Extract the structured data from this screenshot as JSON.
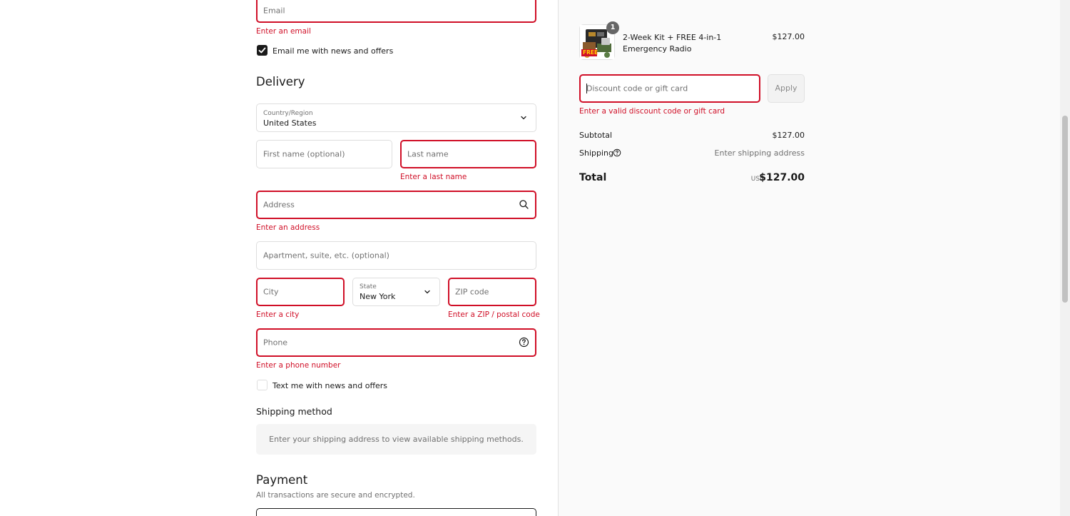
{
  "contact": {
    "email_placeholder": "Email",
    "email_error": "Enter an email",
    "news_checkbox_label": "Email me with news and offers",
    "news_checked": true
  },
  "delivery": {
    "heading": "Delivery",
    "country_label": "Country/Region",
    "country_value": "United States",
    "first_name_placeholder": "First name (optional)",
    "last_name_placeholder": "Last name",
    "last_name_error": "Enter a last name",
    "address_placeholder": "Address",
    "address_error": "Enter an address",
    "apartment_placeholder": "Apartment, suite, etc. (optional)",
    "city_placeholder": "City",
    "city_error": "Enter a city",
    "state_label": "State",
    "state_value": "New York",
    "zip_placeholder": "ZIP code",
    "zip_error": "Enter a ZIP / postal code",
    "phone_placeholder": "Phone",
    "phone_error": "Enter a phone number",
    "sms_checkbox_label": "Text me with news and offers",
    "sms_checked": false
  },
  "shipping_method": {
    "heading": "Shipping method",
    "notice": "Enter your shipping address to view available shipping methods."
  },
  "payment": {
    "heading": "Payment",
    "subtext": "All transactions are secure and encrypted."
  },
  "summary": {
    "item": {
      "quantity": "1",
      "name": "2-Week Kit + FREE 4-in-1 Emergency Radio",
      "price": "$127.00",
      "thumb_text": "FREE"
    },
    "discount_placeholder": "Discount code or gift card",
    "apply_label": "Apply",
    "discount_error": "Enter a valid discount code or gift card",
    "subtotal_label": "Subtotal",
    "subtotal_value": "$127.00",
    "shipping_label": "Shipping",
    "shipping_value": "Enter shipping address",
    "total_label": "Total",
    "total_currency": "USD",
    "total_value": "$127.00"
  },
  "colors": {
    "error": "#d00f27",
    "text": "#1a1a1a",
    "muted": "#707070",
    "summary_bg": "#fafafa"
  }
}
